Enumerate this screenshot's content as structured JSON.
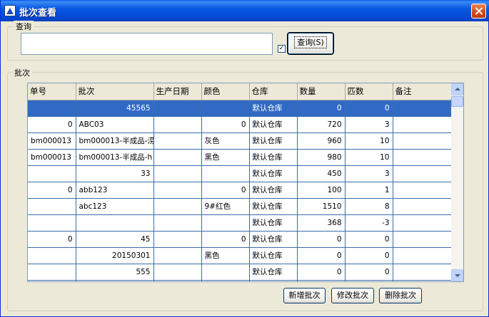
{
  "window": {
    "title": "批次查看"
  },
  "search_group": {
    "legend": "查询",
    "input_value": "",
    "check_mark": "✓",
    "query_button": "查询(S)"
  },
  "batch_group": {
    "legend": "批次"
  },
  "grid": {
    "columns": [
      "单号",
      "批次",
      "生产日期",
      "颜色",
      "仓库",
      "数量",
      "匹数",
      "备注"
    ],
    "rows": [
      [
        "",
        "45565",
        "",
        "",
        "默认仓库",
        "0",
        "0",
        ""
      ],
      [
        "0",
        "ABC03",
        "",
        "0",
        "默认仓库",
        "720",
        "3",
        ""
      ],
      [
        "bm000013",
        "bm000013-半成品-涝",
        "",
        "灰色",
        "默认仓库",
        "960",
        "10",
        ""
      ],
      [
        "bm000013",
        "bm000013-半成品-h",
        "",
        "黑色",
        "默认仓库",
        "980",
        "10",
        ""
      ],
      [
        "",
        "33",
        "",
        "",
        "默认仓库",
        "450",
        "3",
        ""
      ],
      [
        "0",
        "abb123",
        "",
        "0",
        "默认仓库",
        "100",
        "1",
        ""
      ],
      [
        "",
        "abc123",
        "",
        "9#红色",
        "默认仓库",
        "1510",
        "8",
        ""
      ],
      [
        "",
        "",
        "",
        "",
        "默认仓库",
        "368",
        "-3",
        ""
      ],
      [
        "0",
        "45",
        "",
        "0",
        "默认仓库",
        "0",
        "0",
        ""
      ],
      [
        "",
        "20150301",
        "",
        "黑色",
        "默认仓库",
        "0",
        "0",
        ""
      ],
      [
        "",
        "555",
        "",
        "",
        "默认仓库",
        "0",
        "0",
        ""
      ],
      [
        "",
        "",
        "",
        "",
        "",
        "",
        "",
        ""
      ]
    ],
    "selected_row": 0
  },
  "buttons": {
    "add": "新增批次",
    "edit": "修改批次",
    "delete": "删除批次"
  },
  "colors": {
    "title_bar": "#0858e2",
    "selection": "#316ac5",
    "window_bg": "#ece9d8",
    "grid_line": "#3a6ea5"
  }
}
